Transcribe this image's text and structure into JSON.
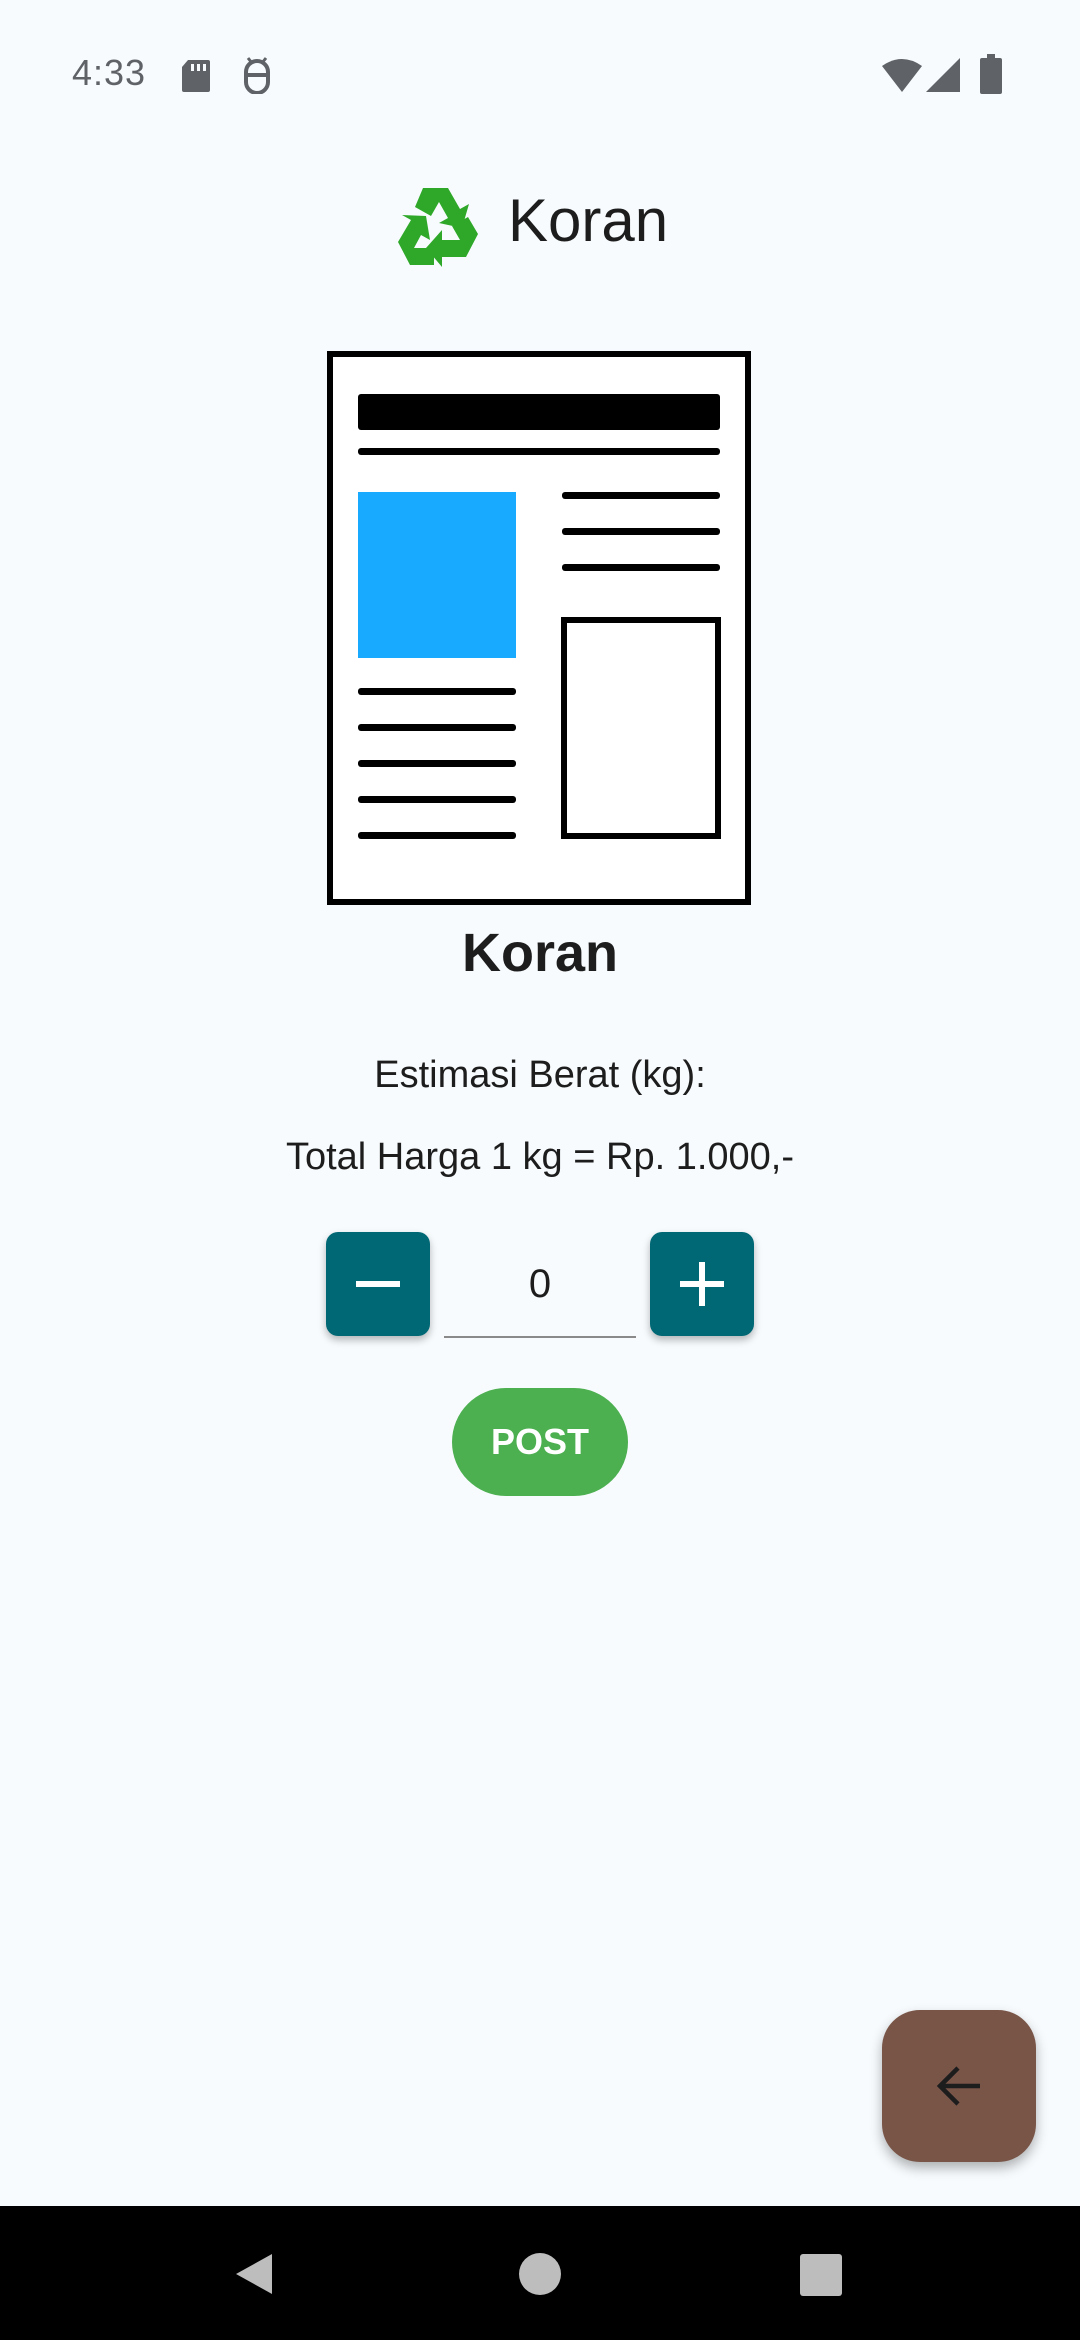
{
  "status_bar": {
    "time": "4:33",
    "icons": [
      "sd-card-icon",
      "android-debug-icon",
      "wifi-icon",
      "cellular-signal-icon",
      "battery-icon"
    ]
  },
  "header": {
    "logo": "recycle-icon",
    "title": "Koran"
  },
  "product": {
    "image": "newspaper-illustration",
    "name": "Koran",
    "weight_label": "Estimasi Berat (kg):",
    "price_label": "Total Harga 1 kg = Rp. 1.000,-"
  },
  "quantity": {
    "value": "0",
    "decrement_icon": "minus-icon",
    "increment_icon": "plus-icon"
  },
  "actions": {
    "post_label": "POST",
    "back_icon": "arrow-back-icon"
  },
  "navigation": {
    "buttons": [
      "nav-back-icon",
      "nav-home-icon",
      "nav-recents-icon"
    ]
  },
  "colors": {
    "background": "#f7fbfd",
    "stepper": "#006875",
    "post_button": "#4caf50",
    "fab": "#795548",
    "newspaper_photo": "#18aaff",
    "recycle_green": "#2fa82a"
  }
}
